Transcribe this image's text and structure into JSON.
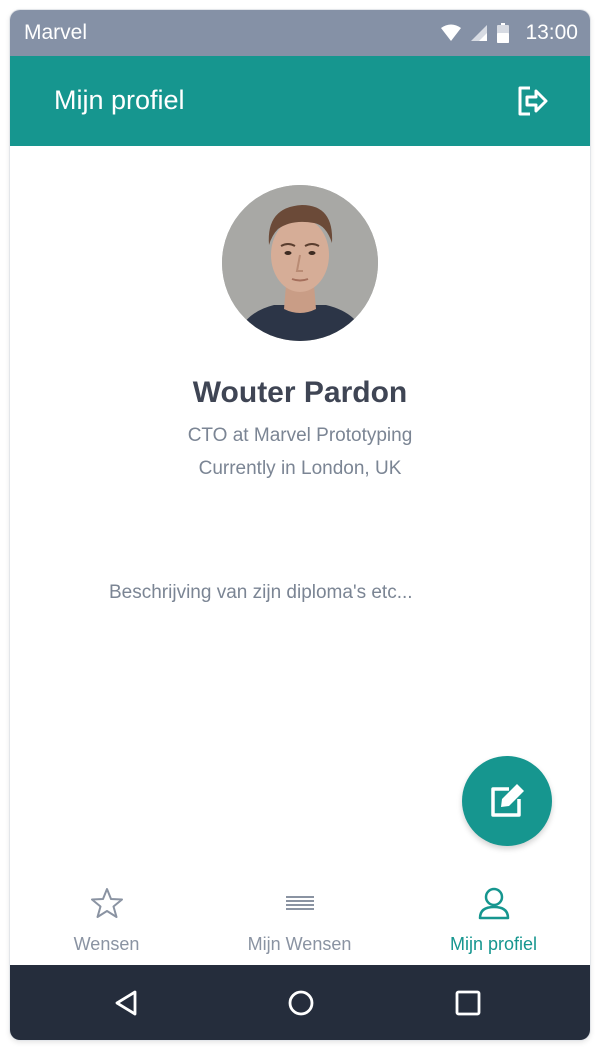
{
  "status_bar": {
    "app_name": "Marvel",
    "time": "13:00",
    "icons": [
      "wifi-icon",
      "signal-icon",
      "battery-icon"
    ]
  },
  "app_bar": {
    "title": "Mijn profiel",
    "action_icon": "logout-icon"
  },
  "profile": {
    "name": "Wouter Pardon",
    "role": "CTO at Marvel Prototyping",
    "location": "Currently in London, UK",
    "description": "Beschrijving van zijn diploma's etc..."
  },
  "fab": {
    "icon": "edit-icon"
  },
  "bottom_nav": {
    "items": [
      {
        "label": "Wensen",
        "icon": "star-icon",
        "active": false
      },
      {
        "label": "Mijn Wensen",
        "icon": "list-icon",
        "active": false
      },
      {
        "label": "Mijn profiel",
        "icon": "person-icon",
        "active": true
      }
    ]
  },
  "system_nav": {
    "buttons": [
      "back-icon",
      "home-icon",
      "recents-icon"
    ]
  },
  "colors": {
    "status_bar": "#8591a6",
    "primary": "#16968f",
    "text_dark": "#3f4554",
    "text_muted": "#7b8594",
    "nav_inactive": "#8a93a2",
    "system_nav": "#252d3c"
  }
}
